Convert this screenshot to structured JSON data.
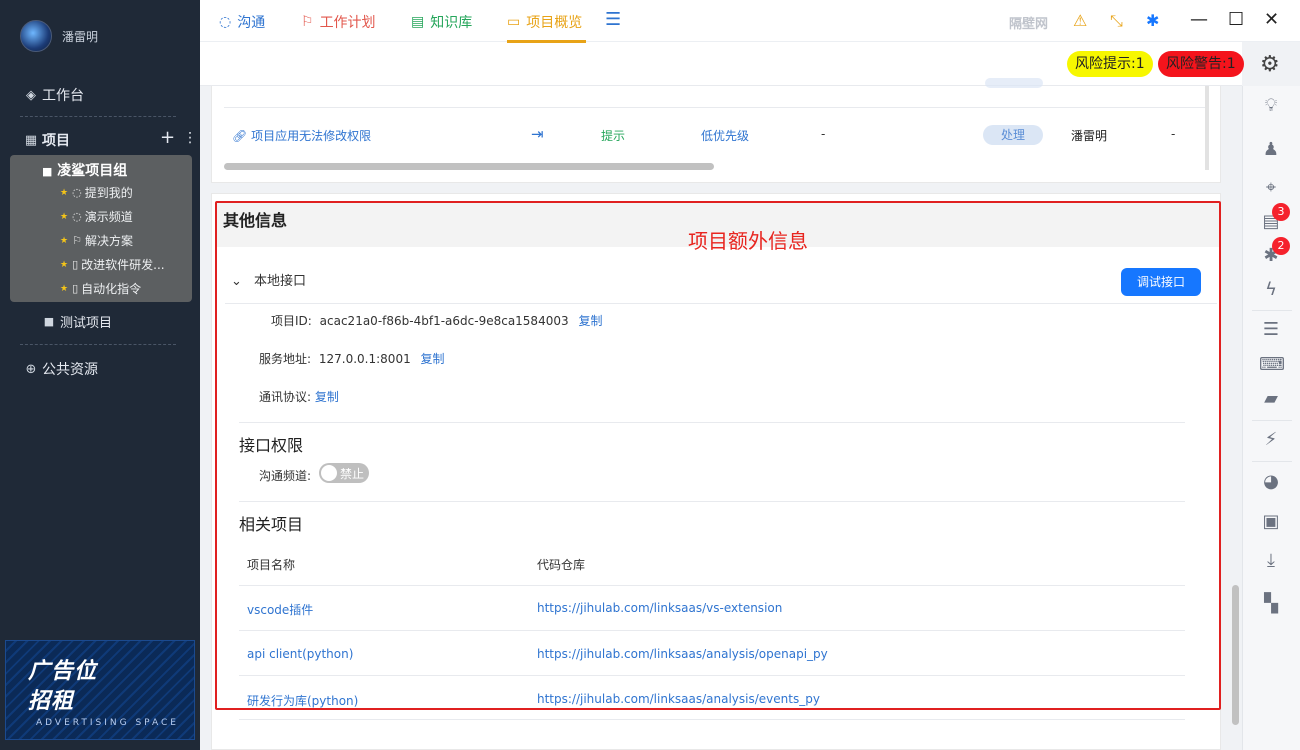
{
  "user": {
    "name": "潘雷明"
  },
  "sidebar": {
    "workbench": "工作台",
    "projects": "项目",
    "group": "凌鲨项目组",
    "group_items": [
      {
        "label": "提到我的",
        "icon": "chat-icon"
      },
      {
        "label": "演示频道",
        "icon": "chat-icon"
      },
      {
        "label": "解决方案",
        "icon": "flag-icon"
      },
      {
        "label": "改进软件研发...",
        "icon": "doc-icon"
      },
      {
        "label": "自动化指令",
        "icon": "doc-icon"
      }
    ],
    "test_project": "测试项目",
    "public": "公共资源",
    "ad": {
      "line1": "广告位",
      "line2": "招租",
      "sub": "ADVERTISING SPACE"
    }
  },
  "titlebar": {
    "brand": "隔壁网"
  },
  "tabs": [
    {
      "label": "沟通",
      "color": "#2f74d0",
      "icon": "chat-icon"
    },
    {
      "label": "工作计划",
      "color": "#e2574c",
      "icon": "flag-icon"
    },
    {
      "label": "知识库",
      "color": "#26a65b",
      "icon": "doc-icon"
    },
    {
      "label": "项目概览",
      "color": "#e8a317",
      "icon": "overview-icon"
    }
  ],
  "risk": {
    "hint": "风险提示:1",
    "warn": "风险警告:1"
  },
  "issue_row": {
    "title": "项目应用无法修改权限",
    "level": "提示",
    "priority": "低优先级",
    "dash1": "-",
    "action": "处理",
    "owner": "潘雷明",
    "dash2": "-"
  },
  "other": {
    "title": "其他信息",
    "annotation": "项目额外信息",
    "local_api": "本地接口",
    "debug_btn": "调试接口",
    "project_id_label": "项目ID:",
    "project_id": "acac21a0-f86b-4bf1-a6dc-9e8ca1584003",
    "copy": "复制",
    "service_label": "服务地址:",
    "service": "127.0.0.1:8001",
    "protocol_label": "通讯协议:",
    "perm_title": "接口权限",
    "channel_label": "沟通频道:",
    "switch_text": "禁止",
    "related_title": "相关项目",
    "col_name": "项目名称",
    "col_repo": "代码仓库",
    "related": [
      {
        "name": "vscode插件",
        "repo": "https://jihulab.com/linksaas/vs-extension"
      },
      {
        "name": "api client(python)",
        "repo": "https://jihulab.com/linksaas/analysis/openapi_py"
      },
      {
        "name": "研发行为库(python)",
        "repo": "https://jihulab.com/linksaas/analysis/events_py"
      }
    ]
  },
  "badges": {
    "doc": "3",
    "bug": "2"
  }
}
